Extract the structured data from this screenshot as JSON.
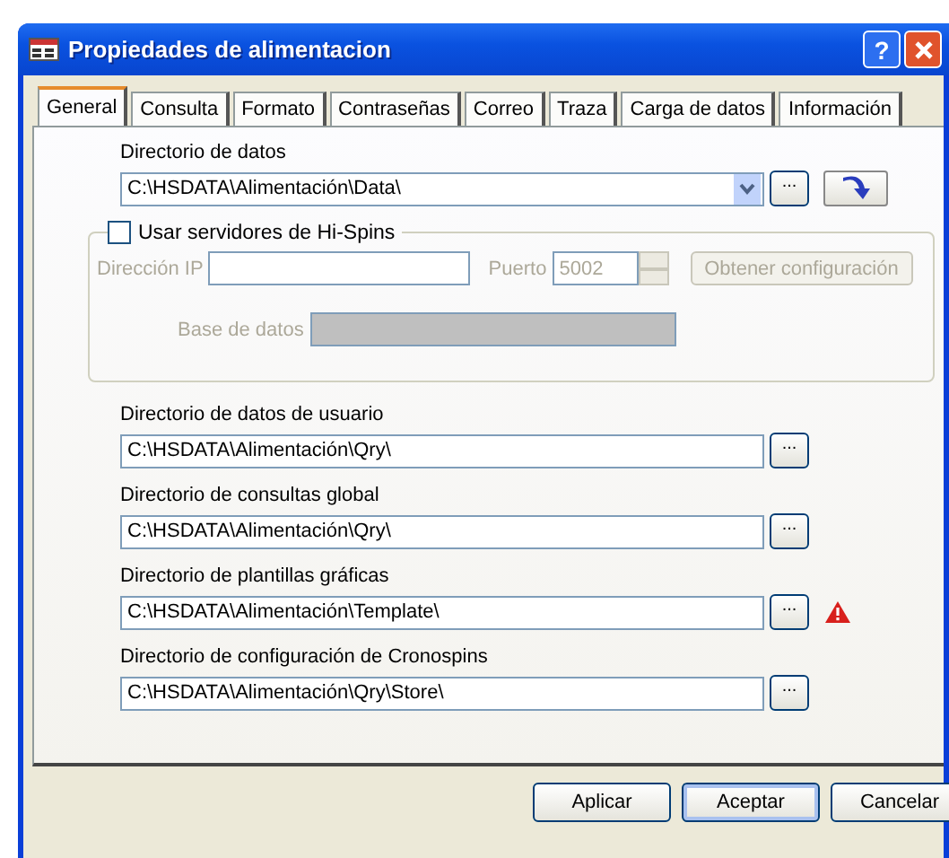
{
  "window": {
    "title": "Propiedades de alimentacion",
    "help_button": "?"
  },
  "tabs": [
    {
      "label": "General",
      "selected": true
    },
    {
      "label": "Consulta",
      "selected": false
    },
    {
      "label": "Formato",
      "selected": false
    },
    {
      "label": "Contraseñas",
      "selected": false
    },
    {
      "label": "Correo",
      "selected": false
    },
    {
      "label": "Traza",
      "selected": false
    },
    {
      "label": "Carga de datos",
      "selected": false
    },
    {
      "label": "Información",
      "selected": false
    }
  ],
  "data_directory": {
    "label": "Directorio de datos",
    "value": "C:\\HSDATA\\Alimentación\\Data\\",
    "browse": "..."
  },
  "hispins": {
    "label": "Usar servidores de Hi-Spins",
    "checked": false,
    "ip_label": "Dirección IP",
    "port_label": "Puerto",
    "port_value": "5002",
    "get_config_button": "Obtener configuración",
    "database_label": "Base de datos"
  },
  "directories": [
    {
      "label": "Directorio de datos de usuario",
      "value": "C:\\HSDATA\\Alimentación\\Qry\\",
      "browse": "...",
      "warning": false
    },
    {
      "label": "Directorio de consultas global",
      "value": "C:\\HSDATA\\Alimentación\\Qry\\",
      "browse": "...",
      "warning": false
    },
    {
      "label": "Directorio de plantillas gráficas",
      "value": "C:\\HSDATA\\Alimentación\\Template\\",
      "browse": "...",
      "warning": true
    },
    {
      "label": "Directorio de configuración de Cronospins",
      "value": "C:\\HSDATA\\Alimentación\\Qry\\Store\\",
      "browse": "...",
      "warning": false
    }
  ],
  "buttons": [
    {
      "label": "Aplicar",
      "default": false
    },
    {
      "label": "Aceptar",
      "default": true
    },
    {
      "label": "Cancelar",
      "default": false
    }
  ]
}
